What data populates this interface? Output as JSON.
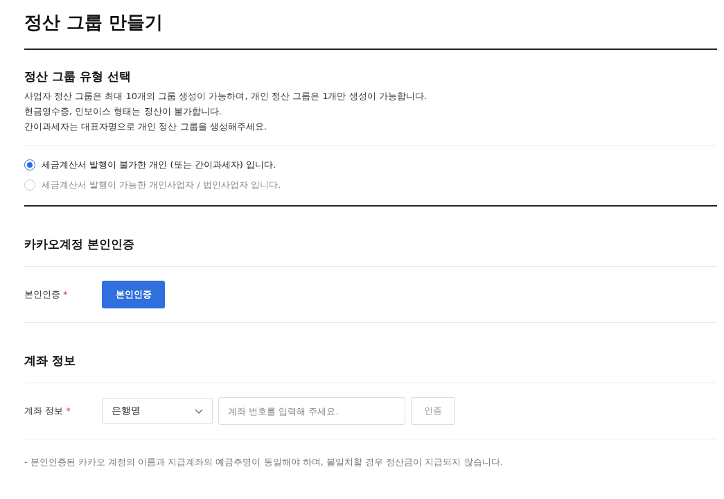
{
  "page_title": "정산 그룹 만들기",
  "group_type": {
    "heading": "정산 그룹 유형 선택",
    "description": [
      "사업자 정산 그룹은 최대 10개의 그룹 생성이 가능하며, 개인 정산 그룹은 1개만 생성이 가능합니다.",
      "현금영수증, 인보이스 형태는 정산이 불가합니다.",
      "간이과세자는 대표자명으로 개인 정산 그룹을 생성해주세요."
    ],
    "options": [
      {
        "label": "세금계산서 발행이 불가한 개인 (또는 간이과세자) 입니다.",
        "selected": true
      },
      {
        "label": "세금계산서 발행이 가능한 개인사업자 / 법인사업자 입니다.",
        "selected": false
      }
    ]
  },
  "verification": {
    "heading": "카카오계정 본인인증",
    "label": "본인인증",
    "required_mark": "*",
    "button": "본인인증"
  },
  "account": {
    "heading": "계좌 정보",
    "label": "계좌 정보",
    "required_mark": "*",
    "bank_select": {
      "value": "은행명"
    },
    "number_field": {
      "placeholder": "계좌 번호를 입력해 주세요."
    },
    "verify_button": {
      "label": "인증",
      "disabled": true
    }
  },
  "note": "- 본인인증된 카카오 계정의 이름과 지급계좌의 예금주명이 동일해야 하며, 불일치할 경우 정산금이 지급되지 않습니다."
}
